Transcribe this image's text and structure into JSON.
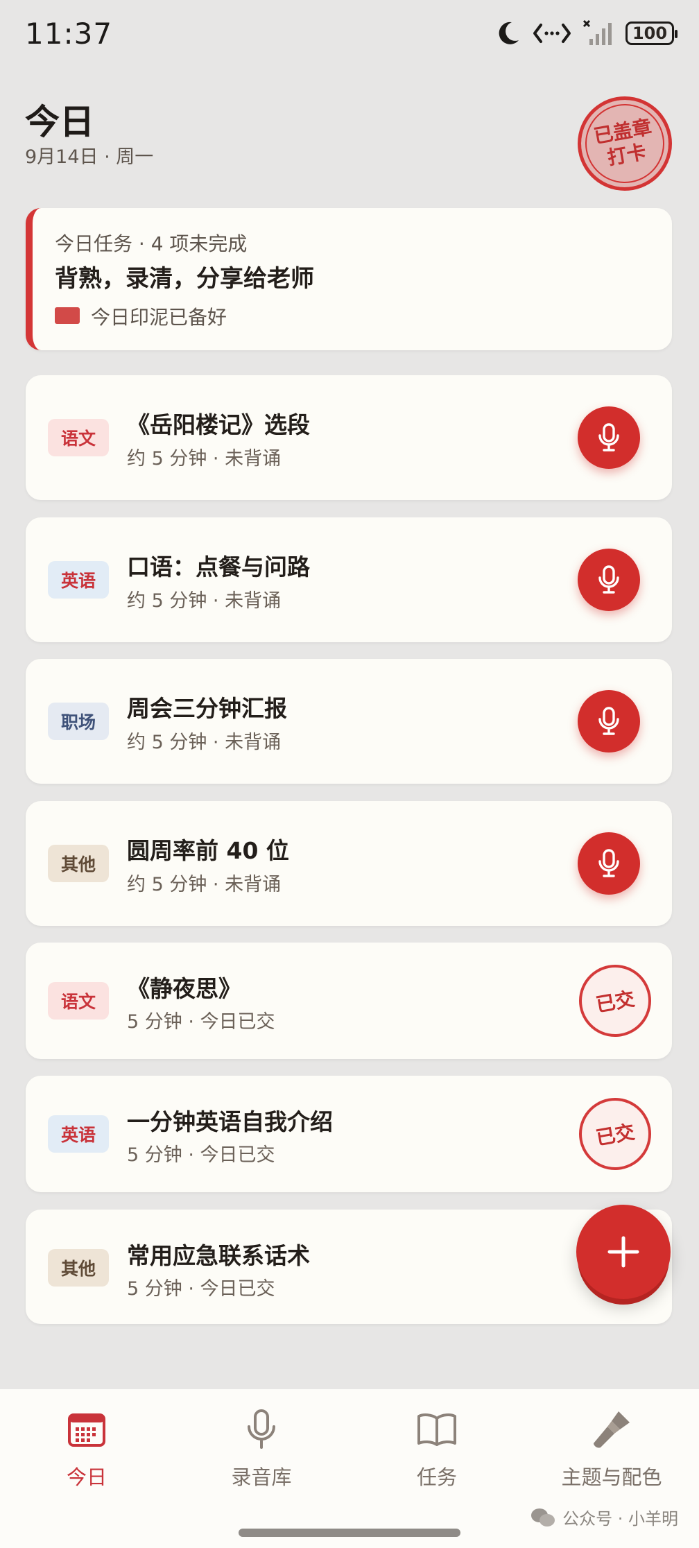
{
  "status_bar": {
    "time": "11:37",
    "battery": "100"
  },
  "header": {
    "title": "今日",
    "date": "9月14日 · 周一",
    "stamp_line1": "已盖章",
    "stamp_line2": "打卡"
  },
  "summary": {
    "caption": "今日任务 · 4 项未完成",
    "headline": "背熟，录清，分享给老师",
    "ink_note": "今日印泥已备好"
  },
  "tasks": [
    {
      "tag": "语文",
      "title": "《岳阳楼记》选段",
      "subtitle": "约 5 分钟 · 未背诵",
      "status": "pending"
    },
    {
      "tag": "英语",
      "title": "口语：点餐与问路",
      "subtitle": "约 5 分钟 · 未背诵",
      "status": "pending"
    },
    {
      "tag": "职场",
      "title": "周会三分钟汇报",
      "subtitle": "约 5 分钟 · 未背诵",
      "status": "pending"
    },
    {
      "tag": "其他",
      "title": "圆周率前 40 位",
      "subtitle": "约 5 分钟 · 未背诵",
      "status": "pending"
    },
    {
      "tag": "语文",
      "title": "《静夜思》",
      "subtitle": "5 分钟 · 今日已交",
      "status": "done",
      "badge": "已交"
    },
    {
      "tag": "英语",
      "title": "一分钟英语自我介绍",
      "subtitle": "5 分钟 · 今日已交",
      "status": "done",
      "badge": "已交"
    },
    {
      "tag": "其他",
      "title": "常用应急联系话术",
      "subtitle": "5 分钟 · 今日已交",
      "status": "done"
    }
  ],
  "fab": {
    "icon": "plus-icon"
  },
  "nav": [
    {
      "label": "今日",
      "icon": "calendar-icon",
      "active": true
    },
    {
      "label": "录音库",
      "icon": "microphone-icon",
      "active": false
    },
    {
      "label": "任务",
      "icon": "book-icon",
      "active": false
    },
    {
      "label": "主题与配色",
      "icon": "paintbrush-icon",
      "active": false
    }
  ],
  "watermark": "公众号 · 小羊明",
  "colors": {
    "accent": "#d22e2c",
    "card": "#fdfcf7",
    "background": "#e7e6e5"
  }
}
